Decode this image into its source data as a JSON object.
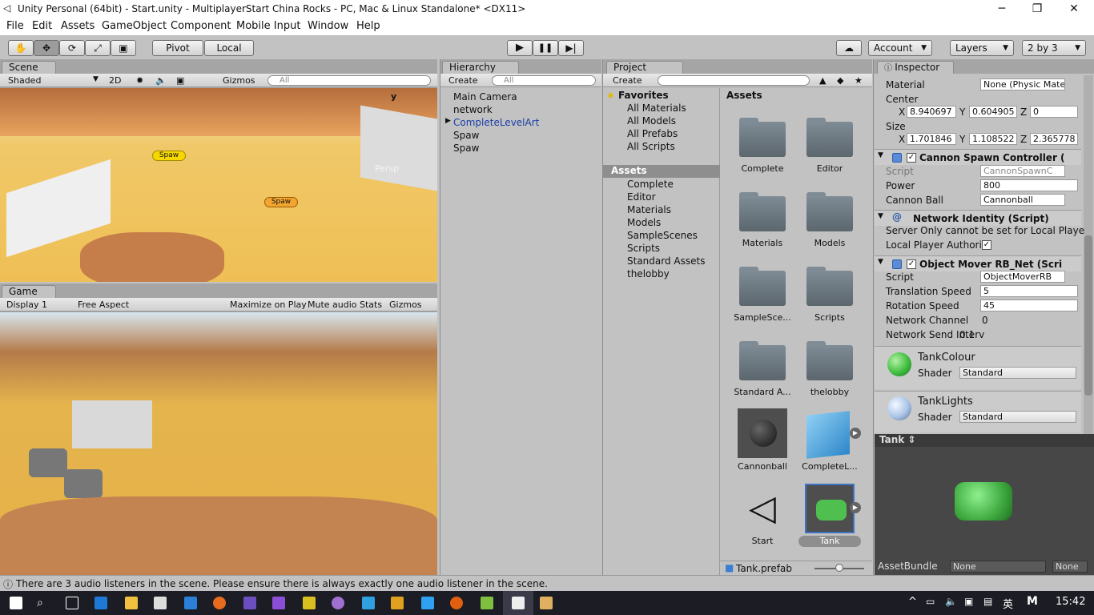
{
  "window": {
    "title": "Unity Personal (64bit) - Start.unity - MultiplayerStart China Rocks - PC, Mac & Linux Standalone* <DX11>",
    "minimize": "─",
    "maximize": "❐",
    "close": "✕"
  },
  "menu": [
    "File",
    "Edit",
    "Assets",
    "GameObject",
    "Component",
    "Mobile Input",
    "Window",
    "Help"
  ],
  "toolbar": {
    "pivot": "Pivot",
    "local": "Local",
    "account": "Account",
    "layers": "Layers",
    "layout": "2 by 3"
  },
  "scene": {
    "tab": "Scene",
    "shading": "Shaded",
    "mode2d": "2D",
    "gizmos": "Gizmos",
    "search": "All",
    "persp": "Persp",
    "axis_y": "y",
    "labels": [
      "Spaw",
      "Spaw"
    ]
  },
  "game": {
    "tab": "Game",
    "display": "Display 1",
    "aspect": "Free Aspect",
    "maximize": "Maximize on Play",
    "mute": "Mute audio",
    "stats": "Stats",
    "gizmos": "Gizmos"
  },
  "hierarchy": {
    "tab": "Hierarchy",
    "create": "Create",
    "search": "All",
    "items": [
      "Main Camera",
      "network",
      "CompleteLevelArt",
      "Spaw",
      "Spaw"
    ]
  },
  "project": {
    "tab": "Project",
    "create": "Create",
    "favorites": "Favorites",
    "fav_items": [
      "All Materials",
      "All Models",
      "All Prefabs",
      "All Scripts"
    ],
    "assets_root": "Assets",
    "tree": [
      "Complete",
      "Editor",
      "Materials",
      "Models",
      "SampleScenes",
      "Scripts",
      "Standard Assets",
      "thelobby"
    ],
    "breadcrumb": "Assets",
    "grid": [
      "Complete",
      "Editor",
      "Materials",
      "Models",
      "SampleSce...",
      "Scripts",
      "Standard A...",
      "thelobby",
      "Cannonball",
      "CompleteL...",
      "Start",
      "Tank"
    ],
    "selected_file": "Tank.prefab"
  },
  "inspector": {
    "tab": "Inspector",
    "collider": {
      "material_label": "Material",
      "material_value": "None (Physic Mate",
      "center_label": "Center",
      "center": {
        "x": "8.940697",
        "y": "0.604905",
        "z": "0"
      },
      "size_label": "Size",
      "size": {
        "x": "1.701846",
        "y": "1.108522",
        "z": "2.365778"
      },
      "x": "X",
      "y": "Y",
      "z": "Z"
    },
    "cannon": {
      "title": "Cannon Spawn Controller (",
      "script_label": "Script",
      "script_value": "CannonSpawnC",
      "power_label": "Power",
      "power_value": "800",
      "ball_label": "Cannon Ball",
      "ball_value": "Cannonball"
    },
    "netid": {
      "title": "Network Identity (Script)",
      "server_only": "Server Only cannot be set for Local Playe",
      "local_label": "Local Player Authorit"
    },
    "mover": {
      "title": "Object Mover RB_Net (Scri",
      "script_label": "Script",
      "script_value": "ObjectMoverRB",
      "trans_label": "Translation Speed",
      "trans_value": "5",
      "rot_label": "Rotation Speed",
      "rot_value": "45",
      "chan_label": "Network Channel",
      "chan_value": "0",
      "send_label": "Network Send Interv",
      "send_value": "0.1"
    },
    "mat1": {
      "name": "TankColour",
      "shader_label": "Shader",
      "shader": "Standard",
      "color": "#3fbf3f"
    },
    "mat2": {
      "name": "TankLights",
      "shader_label": "Shader",
      "shader": "Standard",
      "color": "#aac4e8"
    },
    "preview": {
      "title": "Tank",
      "assetbundle": "AssetBundle",
      "none1": "None",
      "none2": "None"
    }
  },
  "status": {
    "message": "There are 3 audio listeners in the scene. Please ensure there is always exactly one audio listener in the scene."
  },
  "taskbar": {
    "time": "15:42",
    "ime": "英",
    "ime2": "M"
  }
}
